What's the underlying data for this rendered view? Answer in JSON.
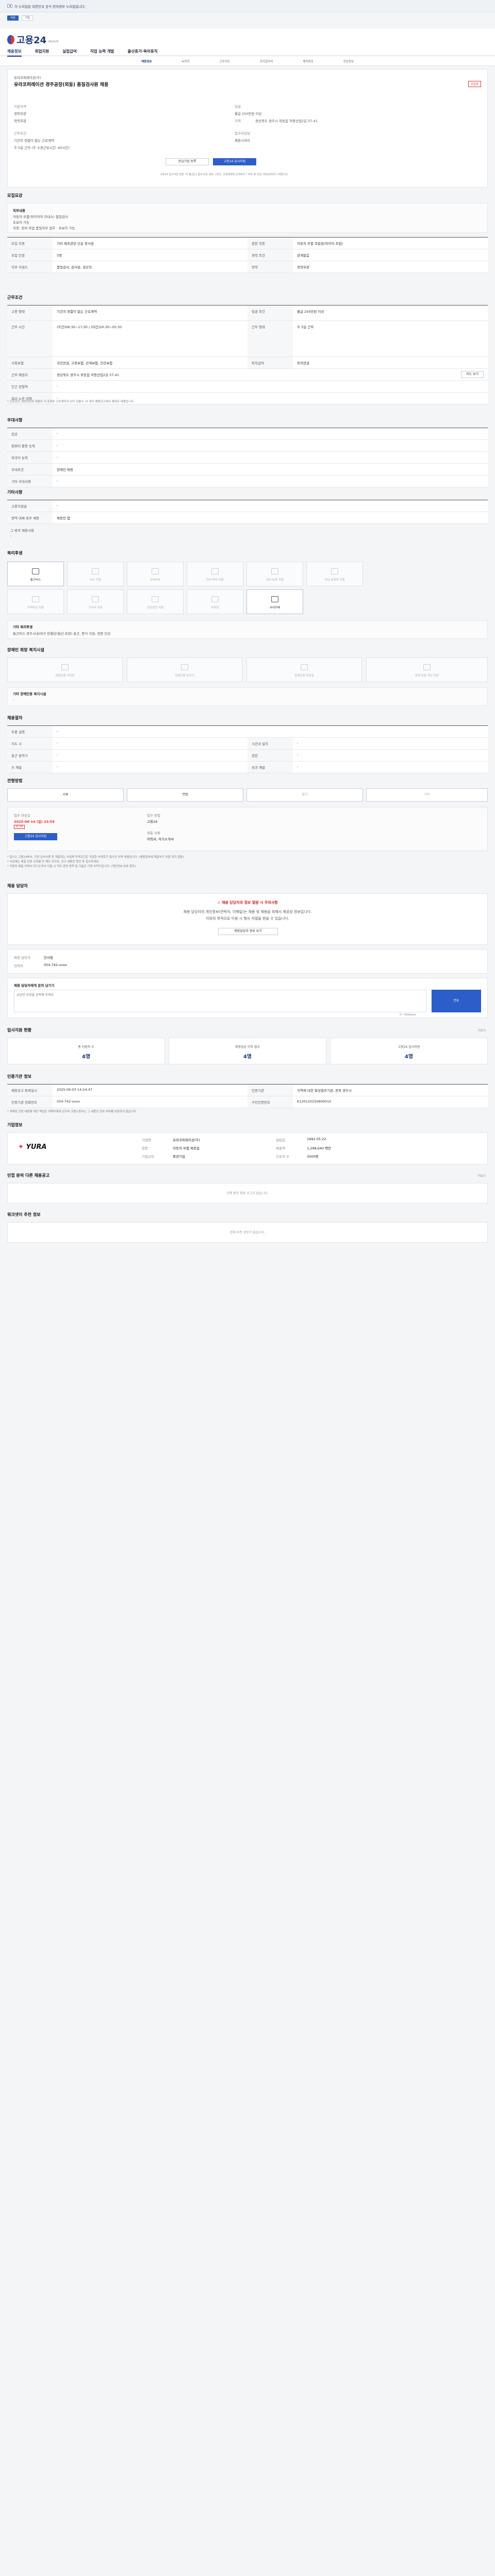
{
  "gov": {
    "banner": "이 누리집은 대한민국 공식 전자정부 누리집입니다.",
    "mode_a": "국문",
    "mode_b": "기업"
  },
  "header": {
    "logo": "고용24",
    "logo_sub": "Work24",
    "nav": [
      "채용정보",
      "취업지원",
      "실업급여",
      "직업 능력 개발",
      "출산휴가·육아휴직"
    ]
  },
  "subnav": [
    "채용정보",
    "AI추천",
    "근무지도",
    "한국일자리",
    "해외취업",
    "전문정보"
  ],
  "job": {
    "company": "유라코퍼레이션(주)",
    "title": "유라코퍼레이션 경주공장(외동) 품질검사원 채용",
    "experience_label": "지원자격",
    "experience_value": "경력무관",
    "education_value": "학력무관",
    "employment_label": "근무조건",
    "employment_value": "기간의 정함이 없는 근로계약",
    "wage_label": "임금",
    "wage_value": "월급 250만원 이상",
    "location_label": "지역",
    "location_value": "경상북도 경주시 외동읍 처용산업2길 57-41",
    "work_type_value": "주 5일 근무 (주 소정근로시간: 40시간)",
    "deadline_label": "접수마감일",
    "deadline_value": "채용시까지",
    "status_badge": "모집중",
    "interest_button": "관심기업 등록",
    "apply_button": "고용24 입사지원",
    "apply_note": "고용24 입사지원 관련 '자 필)입니 결과 모든 정보 <한다: 사업체에게 공개되지 * 부트 후 지원 이력/관리하기 바랍니다."
  },
  "recruit": {
    "title": "모집요강",
    "duty_label": "직무내용",
    "duty_lines": [
      "자동차 부품(와이어하 하네스) 품질검사",
      "초보자 가능"
    ],
    "duty_extra": "직종: 장비 작업 품질직무 업무 · 초보자 가능",
    "rows": [
      {
        "k": "모집 직종",
        "v": "기타 제조관련 단순 종사원",
        "k2": "관련 직종",
        "v2": "자동차 부품 조립원(와이어 조립)"
      },
      {
        "k": "모집 인원",
        "v": "5명",
        "k2": "경력 조건",
        "v2": "관계없음"
      },
      {
        "k": "직무 키워드",
        "v": "품질검사, 검사원, 생산직",
        "k2": "학력",
        "v2": "학력무관"
      }
    ]
  },
  "conditions": {
    "title": "근무조건",
    "rows": [
      {
        "k": "고용 형태",
        "v": "기간의 정함이 없는 근로계약",
        "k2": "임금 조건",
        "v2": "월급 250만원 이상"
      },
      {
        "k": "근무 시간",
        "v": "(주간)08:30~17:30 / (야간)20:30~05:30",
        "k2": "근무 형태",
        "v2": "주 5일 근무"
      },
      {
        "k": "사회보험",
        "v": "국민연금, 고용보험, 산재보험, 건강보험",
        "k2": "퇴직급여",
        "v2": "퇴직연금"
      },
      {
        "k": "근무 예정지",
        "v": "경상북도 경주시 외동읍 처용산업2길 57-41",
        "k2": "",
        "v2": ""
      },
      {
        "k": "인근 전철역",
        "v": "-",
        "k2": "",
        "v2": ""
      },
      {
        "k": "복리 노후 대책",
        "v": "-",
        "k2": "",
        "v2": ""
      }
    ],
    "map_button": "지도 보기",
    "note": "* 근로조건 과반이상의 내용이 기 조회부 근로계약과 상이 있을수, 이 경우 채용공고에서 제외된 내용입니다."
  },
  "prefs": {
    "title": "우대사항",
    "rows": [
      [
        "전공",
        "-"
      ],
      [
        "컴퓨터 활용 능력",
        "-"
      ],
      [
        "외국어 능력",
        "-"
      ],
      [
        "우대조건",
        "장애인 채용"
      ],
      [
        "기타 우대사항",
        "-"
      ]
    ]
  },
  "other": {
    "title": "기타사항",
    "rows": [
      [
        "고용지원금",
        "-"
      ],
      [
        "병역 대체 복무 채용",
        "채용안 함"
      ]
    ],
    "extra_label": "그 밖의 채용사항",
    "extra_value": "-"
  },
  "welfare": {
    "title": "복리후생",
    "tiles": [
      "통근버스",
      "식사 지원",
      "사내식당",
      "자녀 학비 지원",
      "자녀 보육 지원",
      "자녀 보육비 지원",
      "주택자금 지원",
      "기숙사 지원",
      "건강검진 지원",
      "주차장",
      "사내카페",
      "사내 휴게실"
    ],
    "detail_label": "기타 복리후생",
    "detail_value": "통근버스 경주시내/대구 반월당(울산 포항) 출근, 중식 지원, 연봉 인상"
  },
  "disability": {
    "title": "장애인 희망 복지시설",
    "tiles": [
      "장애인용 주차장",
      "장애인용 승강기",
      "장애인용 화장실",
      "장애 유형 개선 지원"
    ],
    "detail_label": "기타 장애인용 복지시설",
    "detail_value": "-"
  },
  "process": {
    "title": "채용절차",
    "rows": [
      [
        "부품 설명",
        "-",
        "",
        ""
      ],
      [
        "지도 시",
        "-",
        "시간내 설치",
        "-"
      ],
      [
        "출근 원하기",
        "-",
        "관련",
        "-"
      ],
      [
        "수 계발",
        "-",
        "성과 계발",
        "-"
      ]
    ]
  },
  "apply": {
    "title": "전형방법",
    "steps": [
      "서류",
      "면접",
      "필기",
      "기타"
    ],
    "left_label": "접수 마감일",
    "left_value": "2025-06-14 (일) 23:59",
    "left_badge": "D-14",
    "left_btn": "고용24 입사지원",
    "right_label": "접수 방법",
    "right_value": "고용24",
    "docs_label": "제출 서류",
    "docs_value": "이력서, 자기소개서",
    "notes": [
      "* 접수는 고용24에서, 지정 입사서류 등 제출하는 사업체 자격조건은 직접한 부계로가 필수인 이력 내용입니다. (채용일부에 제출부가 포함 되지 않음).",
      "* 사업체는 제출 인증 규정을 안 해도 되므로, 공고 내용만 확인 후 접수하세요.",
      "* 지원자 제출 이력서·자기소개서 미흡 시 직무 관련 경력 및 기술은 기재 부탁드립니다. (개인정보 보호 참조)."
    ]
  },
  "contact": {
    "title": "채용 담당자",
    "warning_title": "채용 담당자의 정보 열람 시 주의사항",
    "warning_lines": [
      "채용 담당자의 개인정보(연락처, 이메일)는 채용 및 채용을 위해서 제공된 정보입니다.",
      "이외의 목적으로 이용 시 형사 처벌을 받을 수 있습니다."
    ],
    "reveal_button": "채용담당자 정보 보기",
    "name_label": "채용 담당자",
    "name_value": "인사팀",
    "phone_label": "연락처",
    "phone_value": "054-742-xxxx",
    "q_label": "채용 담당자에게 문의 남기기",
    "q_placeholder": "궁금한 사항을 입력해 주세요",
    "q_count": "0 / 500byte",
    "q_submit": "전송"
  },
  "stats": {
    "title": "입사지원 현황",
    "more": "더보기",
    "items": [
      {
        "k": "총 지원자 수",
        "v": "4명"
      },
      {
        "k": "희망임금 이하 접수",
        "v": "4명"
      },
      {
        "k": "고용24 입사지원",
        "v": "4명"
      }
    ]
  },
  "info": {
    "title": "인증기관 정보",
    "rows": [
      [
        "채용공고 등록일시",
        "2025-06-03 14:24:47",
        "인증기관",
        "지역에 대한 화성엽무기관, 경북 경주시"
      ],
      [
        "인증기관 전화번호",
        "054-742-xxxx",
        "구인인증번호",
        "K120120250600010"
      ]
    ],
    "note": "* 게재된 관련 내용에 대한 책임은 게재자에게 있으며 고용노동부는 그 내용의 진위 여부를 보증하지 않습니다."
  },
  "company": {
    "title": "기업정보",
    "logo": "YURA",
    "rows": [
      [
        "기업명",
        "유라코퍼레이션(주)",
        "설립일",
        "1992.05.22"
      ],
      [
        "업종",
        "자동차 부품 제조업",
        "매출액",
        "1,298,640 백만"
      ],
      [
        "기업규모",
        "중견기업",
        "근로자 수",
        "3000명"
      ]
    ]
  },
  "similar": {
    "title": "인접 분의 다른 채용공고",
    "more": "더보기",
    "empty": "진행 중인 채용 공고가 없습니다."
  },
  "bottom": {
    "title": "워크넷이 추천 정보",
    "empty": "현재 추천 정보가 없습니다."
  }
}
